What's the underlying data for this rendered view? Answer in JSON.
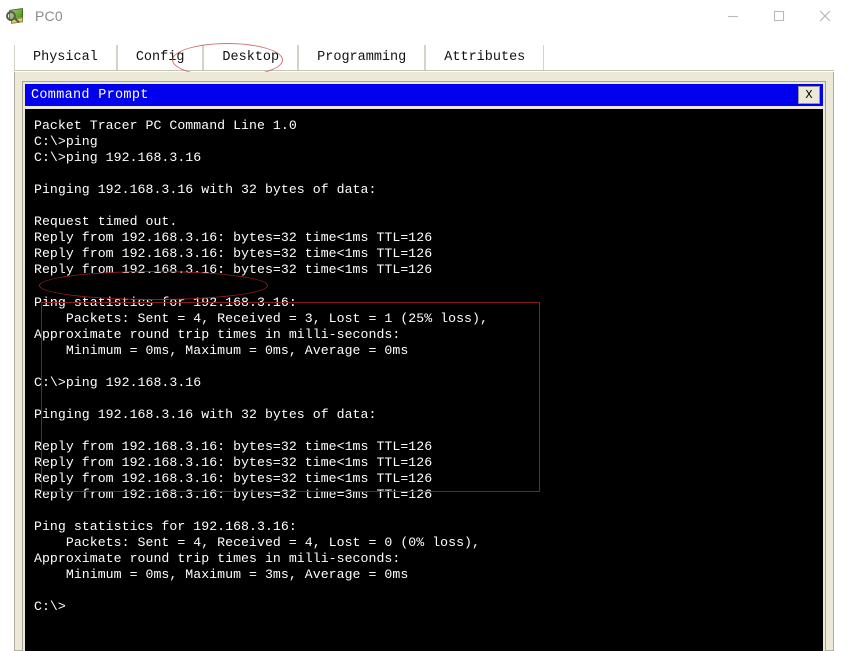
{
  "window": {
    "title": "PC0",
    "icon": "pc-magnifier-icon",
    "controls": [
      {
        "name": "minimize",
        "glyph": "minimize-icon"
      },
      {
        "name": "maximize",
        "glyph": "maximize-icon"
      },
      {
        "name": "close",
        "glyph": "close-icon"
      }
    ]
  },
  "tabs": [
    {
      "label": "Physical",
      "active": false
    },
    {
      "label": "Config",
      "active": false
    },
    {
      "label": "Desktop",
      "active": true
    },
    {
      "label": "Programming",
      "active": false
    },
    {
      "label": "Attributes",
      "active": false
    }
  ],
  "command_prompt": {
    "title": "Command Prompt",
    "close_label": "X",
    "output": "Packet Tracer PC Command Line 1.0\nC:\\>ping\nC:\\>ping 192.168.3.16\n\nPinging 192.168.3.16 with 32 bytes of data:\n\nRequest timed out.\nReply from 192.168.3.16: bytes=32 time<1ms TTL=126\nReply from 192.168.3.16: bytes=32 time<1ms TTL=126\nReply from 192.168.3.16: bytes=32 time<1ms TTL=126\n\nPing statistics for 192.168.3.16:\n    Packets: Sent = 4, Received = 3, Lost = 1 (25% loss),\nApproximate round trip times in milli-seconds:\n    Minimum = 0ms, Maximum = 0ms, Average = 0ms\n\nC:\\>ping 192.168.3.16\n\nPinging 192.168.3.16 with 32 bytes of data:\n\nReply from 192.168.3.16: bytes=32 time<1ms TTL=126\nReply from 192.168.3.16: bytes=32 time<1ms TTL=126\nReply from 192.168.3.16: bytes=32 time<1ms TTL=126\nReply from 192.168.3.16: bytes=32 time=3ms TTL=126\n\nPing statistics for 192.168.3.16:\n    Packets: Sent = 4, Received = 4, Lost = 0 (0% loss),\nApproximate round trip times in milli-seconds:\n    Minimum = 0ms, Maximum = 3ms, Average = 0ms\n\nC:\\>"
  },
  "annotations": {
    "desktop_tab_ellipse": {
      "shape": "ellipse",
      "color": "#c0504d",
      "targets": "Desktop"
    },
    "command_ellipse": {
      "shape": "ellipse",
      "color": "#a02020",
      "targets": "C:\\>ping 192.168.3.16"
    },
    "first_ping_rect": {
      "shape": "rectangle",
      "color": "#8d1f1f",
      "targets": "first ping result block"
    }
  },
  "colors": {
    "titlebar_blue": "#0000ee",
    "panel_beige": "#ece9d8",
    "terminal_bg": "#000000",
    "terminal_fg": "#ffffff",
    "annotation_red": "#a02020"
  }
}
